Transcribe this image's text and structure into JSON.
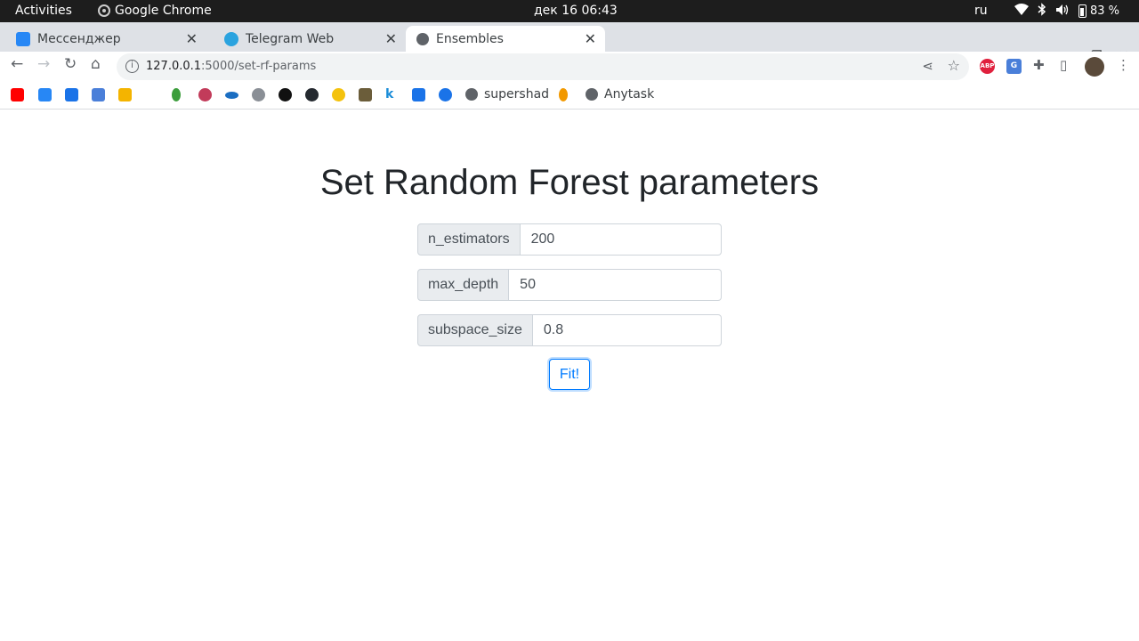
{
  "system_bar": {
    "activities": "Activities",
    "app_name": "Google Chrome",
    "clock": "дек 16  06:43",
    "language": "ru",
    "battery": "83 %"
  },
  "tabs": [
    {
      "title": "Мессенджер",
      "icon": "vk-messenger-icon",
      "color": "#2787f5"
    },
    {
      "title": "Telegram Web",
      "icon": "telegram-icon",
      "color": "#2aa3df"
    },
    {
      "title": "Ensembles",
      "icon": "globe-icon",
      "color": "#5f6368",
      "active": true
    }
  ],
  "omnibox": {
    "url_host": "127.0.0.1",
    "url_rest": ":5000/set-rf-params"
  },
  "bookmarks": {
    "named": [
      {
        "label": "supershad",
        "icon": "globe-icon"
      },
      {
        "label": "Anytask",
        "icon": "globe-icon"
      }
    ]
  },
  "page": {
    "title": "Set Random Forest parameters",
    "fields": [
      {
        "label": "n_estimators",
        "value": "200"
      },
      {
        "label": "max_depth",
        "value": "50"
      },
      {
        "label": "subspace_size",
        "value": "0.8"
      }
    ],
    "submit_label": "Fit!"
  },
  "colors": {
    "primary": "#007bff",
    "addon_bg": "#e9ecef",
    "heading": "#212529"
  }
}
